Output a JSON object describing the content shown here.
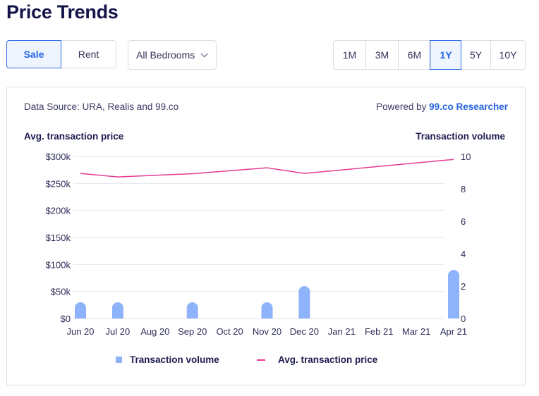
{
  "page_title": "Price Trends",
  "listing_type": {
    "options": [
      {
        "label": "Sale",
        "active": true
      },
      {
        "label": "Rent",
        "active": false
      }
    ]
  },
  "bedrooms_dropdown": {
    "selected": "All Bedrooms"
  },
  "time_ranges": [
    {
      "label": "1M",
      "active": false
    },
    {
      "label": "3M",
      "active": false
    },
    {
      "label": "6M",
      "active": false
    },
    {
      "label": "1Y",
      "active": true
    },
    {
      "label": "5Y",
      "active": false
    },
    {
      "label": "10Y",
      "active": false
    }
  ],
  "card": {
    "data_source": "Data Source: URA, Realis and 99.co",
    "powered_by_prefix": "Powered by ",
    "powered_by_link": "99.co Researcher"
  },
  "colors": {
    "accent": "#2764e0",
    "bar": "#8fb3fb",
    "line": "#e73b8e",
    "text": "#1d1d52"
  },
  "chart_data": {
    "type": "bar+line",
    "categories": [
      "Jun 20",
      "Jul 20",
      "Aug 20",
      "Sep 20",
      "Oct 20",
      "Nov 20",
      "Dec 20",
      "Jan 21",
      "Feb 21",
      "Mar 21",
      "Apr 21"
    ],
    "series": [
      {
        "name": "Transaction volume",
        "type": "bar",
        "axis": "right",
        "values": [
          1,
          1,
          null,
          1,
          null,
          1,
          2,
          null,
          null,
          null,
          3
        ]
      },
      {
        "name": "Avg. transaction price",
        "type": "line",
        "axis": "left",
        "values": [
          268500,
          262000,
          null,
          268000,
          null,
          279000,
          268500,
          null,
          null,
          null,
          294500
        ]
      }
    ],
    "left_axis": {
      "title": "Avg. transaction price",
      "ylim": [
        0,
        300000
      ],
      "ticks": [
        0,
        50000,
        100000,
        150000,
        200000,
        250000,
        300000
      ],
      "tick_labels": [
        "$0",
        "$50k",
        "$100k",
        "$150k",
        "$200k",
        "$250k",
        "$300k"
      ]
    },
    "right_axis": {
      "title": "Transaction volume",
      "ylim": [
        0,
        10
      ],
      "ticks": [
        0,
        2,
        4,
        6,
        8,
        10
      ],
      "tick_labels": [
        "0",
        "2",
        "4",
        "6",
        "8",
        "10"
      ]
    },
    "grid": true,
    "legend": {
      "position": "bottom",
      "entries": [
        {
          "label": "Transaction volume",
          "symbol": "square"
        },
        {
          "label": "Avg. transaction price",
          "symbol": "line"
        }
      ]
    }
  }
}
